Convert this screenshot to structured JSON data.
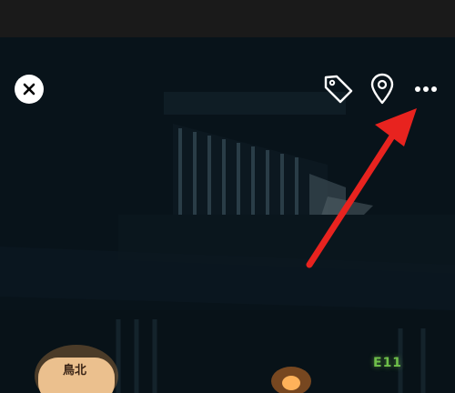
{
  "viewer": {
    "background_color": "#0c0d0f",
    "status_strip_color": "#1a1a1a"
  },
  "toolbar": {
    "close_icon": "close-icon",
    "tag_icon": "tag-icon",
    "location_icon": "location-pin-icon",
    "more_icon": "more-options-icon",
    "icon_color": "#ffffff"
  },
  "photo": {
    "sign_text": "E11",
    "lantern_text": "鳥北",
    "annotation_arrow_color": "#e8231f"
  }
}
